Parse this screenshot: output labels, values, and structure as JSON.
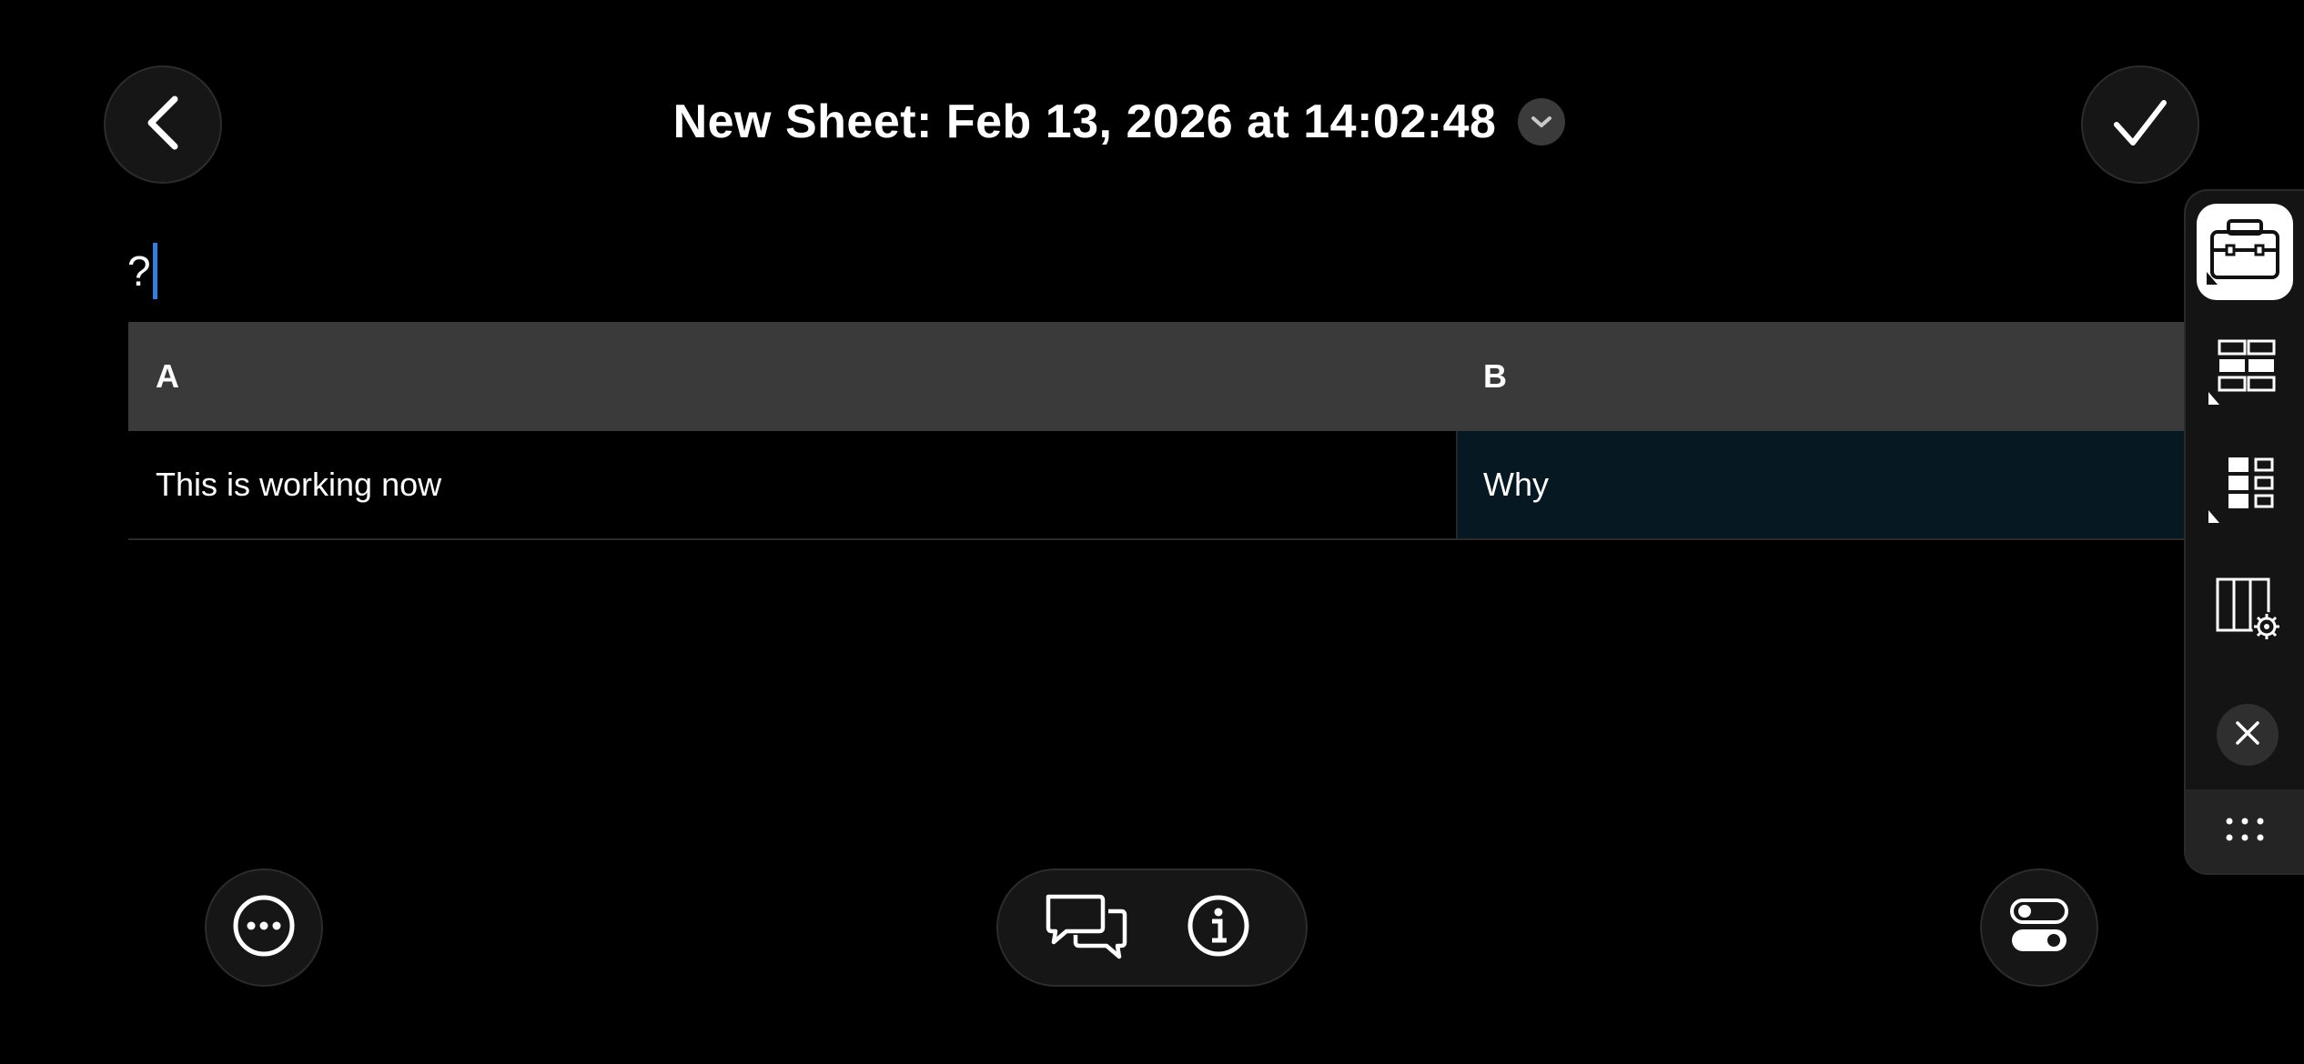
{
  "header": {
    "title": "New Sheet: Feb 13, 2026 at 14:02:48"
  },
  "editor": {
    "value": "?"
  },
  "grid": {
    "columns": [
      "A",
      "B"
    ],
    "rows": [
      [
        "This is working now",
        "Why"
      ]
    ]
  },
  "icons": {
    "back": "chevron-left-icon",
    "done": "checkmark-icon",
    "title_menu": "chevron-down-icon",
    "more": "ellipsis-circle-icon",
    "comments": "chat-bubbles-icon",
    "info": "info-circle-icon",
    "toggles": "toggle-switches-icon",
    "toolbox": "toolbox-icon",
    "row_select": "row-grid-icon",
    "col_select": "column-grid-icon",
    "col_settings": "column-settings-icon",
    "close": "close-icon",
    "panel_more": "dots-grid-icon"
  },
  "colors": {
    "background": "#000000",
    "header_row": "#3a3a3a",
    "selected_cell": "#061822",
    "caret": "#2f7ee0",
    "button_fill": "#161616"
  }
}
